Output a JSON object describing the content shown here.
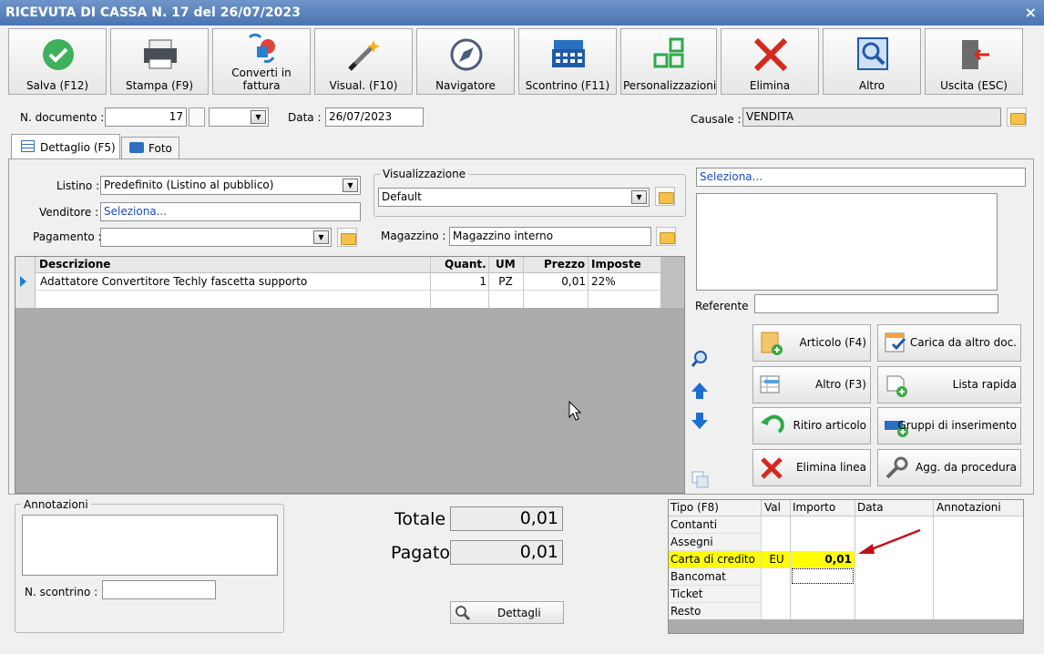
{
  "window": {
    "title": "RICEVUTA DI CASSA N. 17 del 26/07/2023",
    "close": "×"
  },
  "toolbar": [
    {
      "id": "salva",
      "label": "Salva (F12)",
      "icon": "check-icon"
    },
    {
      "id": "stampa",
      "label": "Stampa (F9)",
      "icon": "printer-icon"
    },
    {
      "id": "converti",
      "label": "Converti in\nfattura",
      "icon": "convert-icon"
    },
    {
      "id": "visual",
      "label": "Visual. (F10)",
      "icon": "wand-icon"
    },
    {
      "id": "navigatore",
      "label": "Navigatore",
      "icon": "compass-icon"
    },
    {
      "id": "scontrino",
      "label": "Scontrino (F11)",
      "icon": "cash-register-icon"
    },
    {
      "id": "personalizzazioni",
      "label": "Personalizzazioni",
      "icon": "grid-icon"
    },
    {
      "id": "elimina",
      "label": "Elimina",
      "icon": "delete-icon"
    },
    {
      "id": "altro",
      "label": "Altro",
      "icon": "magnifier-icon"
    },
    {
      "id": "uscita",
      "label": "Uscita (ESC)",
      "icon": "exit-icon"
    }
  ],
  "header": {
    "ndoc_label": "N. documento :",
    "ndoc_value": "17",
    "data_label": "Data :",
    "data_value": "26/07/2023",
    "causale_label": "Causale :",
    "causale_value": "VENDITA"
  },
  "tabs": [
    {
      "label": "Dettaglio (F5)",
      "active": true
    },
    {
      "label": "Foto",
      "active": false
    }
  ],
  "form": {
    "listino_label": "Listino :",
    "listino_value": "Predefinito (Listino al pubblico)",
    "venditore_label": "Venditore :",
    "venditore_value": "Seleziona...",
    "pagamento_label": "Pagamento :",
    "pagamento_value": "",
    "visualizzazione_label": "Visualizzazione",
    "visualizzazione_value": "Default",
    "magazzino_label": "Magazzino :",
    "magazzino_value": "Magazzino interno"
  },
  "grid": {
    "columns": [
      "Descrizione",
      "Quant.",
      "UM",
      "Prezzo",
      "Imposte"
    ],
    "rows": [
      {
        "descrizione": "Adattatore Convertitore Techly fascetta supporto",
        "quant": "1",
        "um": "PZ",
        "prezzo": "0,01",
        "imposte": "22%"
      }
    ]
  },
  "right_panel": {
    "seleziona": "Seleziona...",
    "referente_label": "Referente",
    "buttons": [
      {
        "label": "Articolo (F4)",
        "icon": "add-article-icon"
      },
      {
        "label": "Carica da altro doc.",
        "icon": "load-doc-icon"
      },
      {
        "label": "Altro (F3)",
        "icon": "table-add-icon"
      },
      {
        "label": "Lista rapida",
        "icon": "list-add-icon"
      },
      {
        "label": "Ritiro articolo",
        "icon": "undo-icon"
      },
      {
        "label": "Gruppi di inserimento",
        "icon": "group-add-icon"
      },
      {
        "label": "Elimina linea",
        "icon": "delete-line-icon"
      },
      {
        "label": "Agg. da procedura",
        "icon": "wrench-icon"
      }
    ]
  },
  "annotazioni": {
    "label": "Annotazioni",
    "scontrino_label": "N. scontrino :"
  },
  "totals": {
    "totale_label": "Totale",
    "totale_value": "0,01",
    "pagato_label": "Pagato",
    "pagato_value": "0,01",
    "dettagli_label": "Dettagli"
  },
  "payments": {
    "columns": [
      "Tipo (F8)",
      "Val",
      "Importo",
      "Data",
      "Annotazioni"
    ],
    "rows": [
      {
        "tipo": "Contanti",
        "val": "",
        "importo": ""
      },
      {
        "tipo": "Assegni",
        "val": "",
        "importo": ""
      },
      {
        "tipo": "Carta di credito",
        "val": "EU",
        "importo": "0,01"
      },
      {
        "tipo": "Bancomat",
        "val": "",
        "importo": ""
      },
      {
        "tipo": "Ticket",
        "val": "",
        "importo": ""
      },
      {
        "tipo": "Resto",
        "val": "",
        "importo": ""
      }
    ]
  },
  "colors": {
    "titlebar": "#4a74b2",
    "highlight": "#ffff00",
    "arrow": "#c0101a",
    "link": "#1a4bbf"
  }
}
